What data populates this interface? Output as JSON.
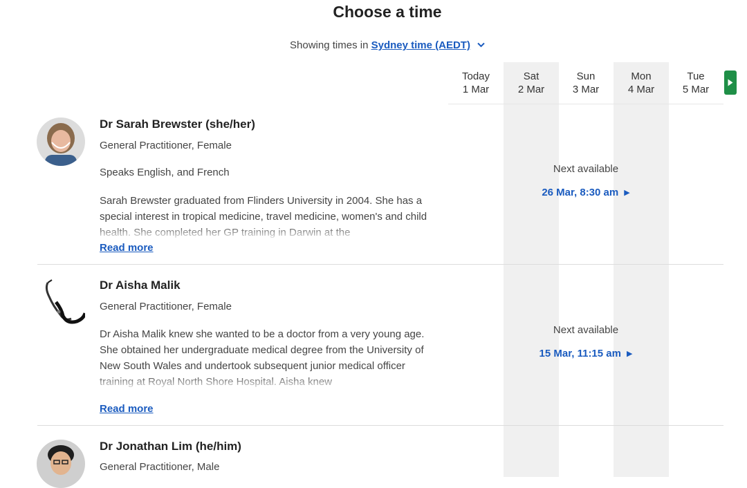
{
  "page": {
    "title": "Choose a time",
    "timezone_prefix": "Showing times in ",
    "timezone_link": "Sydney time (AEDT)"
  },
  "days": [
    {
      "weekday": "Today",
      "date": "1 Mar",
      "shaded": false
    },
    {
      "weekday": "Sat",
      "date": "2 Mar",
      "shaded": true
    },
    {
      "weekday": "Sun",
      "date": "3 Mar",
      "shaded": false
    },
    {
      "weekday": "Mon",
      "date": "4 Mar",
      "shaded": true
    },
    {
      "weekday": "Tue",
      "date": "5 Mar",
      "shaded": false
    }
  ],
  "doctors": [
    {
      "name": "Dr Sarah Brewster (she/her)",
      "role": "General Practitioner, Female",
      "languages": "Speaks English, and French",
      "bio": "Sarah Brewster graduated from Flinders University in 2004. She has a special interest in tropical medicine, travel medicine, women's and child health. She completed her GP training in Darwin at the",
      "read_more": "Read more",
      "next_available_label": "Next available",
      "next_available_time": "26 Mar, 8:30 am"
    },
    {
      "name": "Dr Aisha Malik",
      "role": "General Practitioner, Female",
      "bio": "Dr Aisha Malik knew she wanted to be a doctor from a very young age. She obtained her undergraduate medical degree from the University of New South Wales and undertook subsequent junior medical officer training at Royal North Shore Hospital. Aisha knew",
      "read_more": "Read more",
      "next_available_label": "Next available",
      "next_available_time": "15 Mar, 11:15 am"
    },
    {
      "name": "Dr Jonathan Lim (he/him)",
      "role": "General Practitioner, Male"
    }
  ],
  "icons": {
    "timezone_toggle": "chevron-down-icon",
    "next_days": "play-arrow-icon",
    "slot_arrow": "play-arrow-icon"
  },
  "colors": {
    "link": "#1a5bbf",
    "next_button": "#1f8f47",
    "column_shade": "#f0f0f0"
  }
}
